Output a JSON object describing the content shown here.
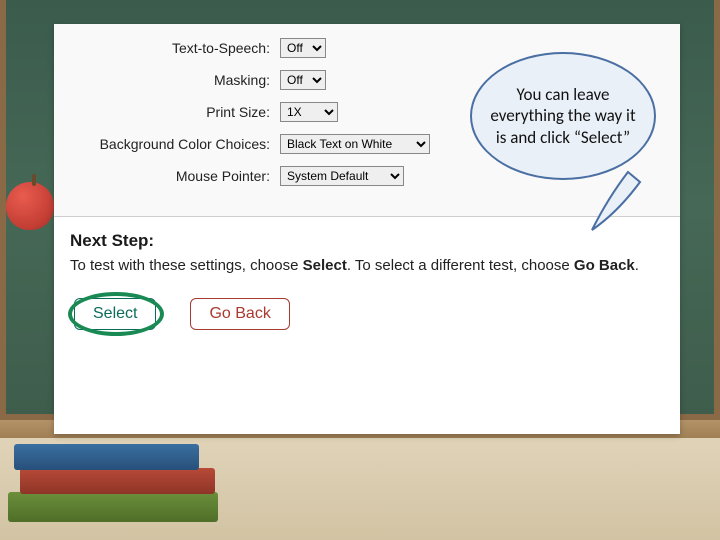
{
  "settings": {
    "tts": {
      "label": "Text-to-Speech:",
      "value": "Off"
    },
    "masking": {
      "label": "Masking:",
      "value": "Off"
    },
    "print": {
      "label": "Print Size:",
      "value": "1X"
    },
    "bgcolor": {
      "label": "Background Color Choices:",
      "value": "Black Text on White"
    },
    "mouse": {
      "label": "Mouse Pointer:",
      "value": "System Default"
    }
  },
  "next_step": {
    "heading": "Next Step:",
    "instr_pre": "To test with these settings, choose ",
    "instr_bold1": "Select",
    "instr_mid": ". To select a different test, choose ",
    "instr_bold2": "Go Back",
    "instr_post": "."
  },
  "buttons": {
    "select": "Select",
    "goback": "Go Back"
  },
  "callout": "You can leave everything the way it is and click “Select”"
}
